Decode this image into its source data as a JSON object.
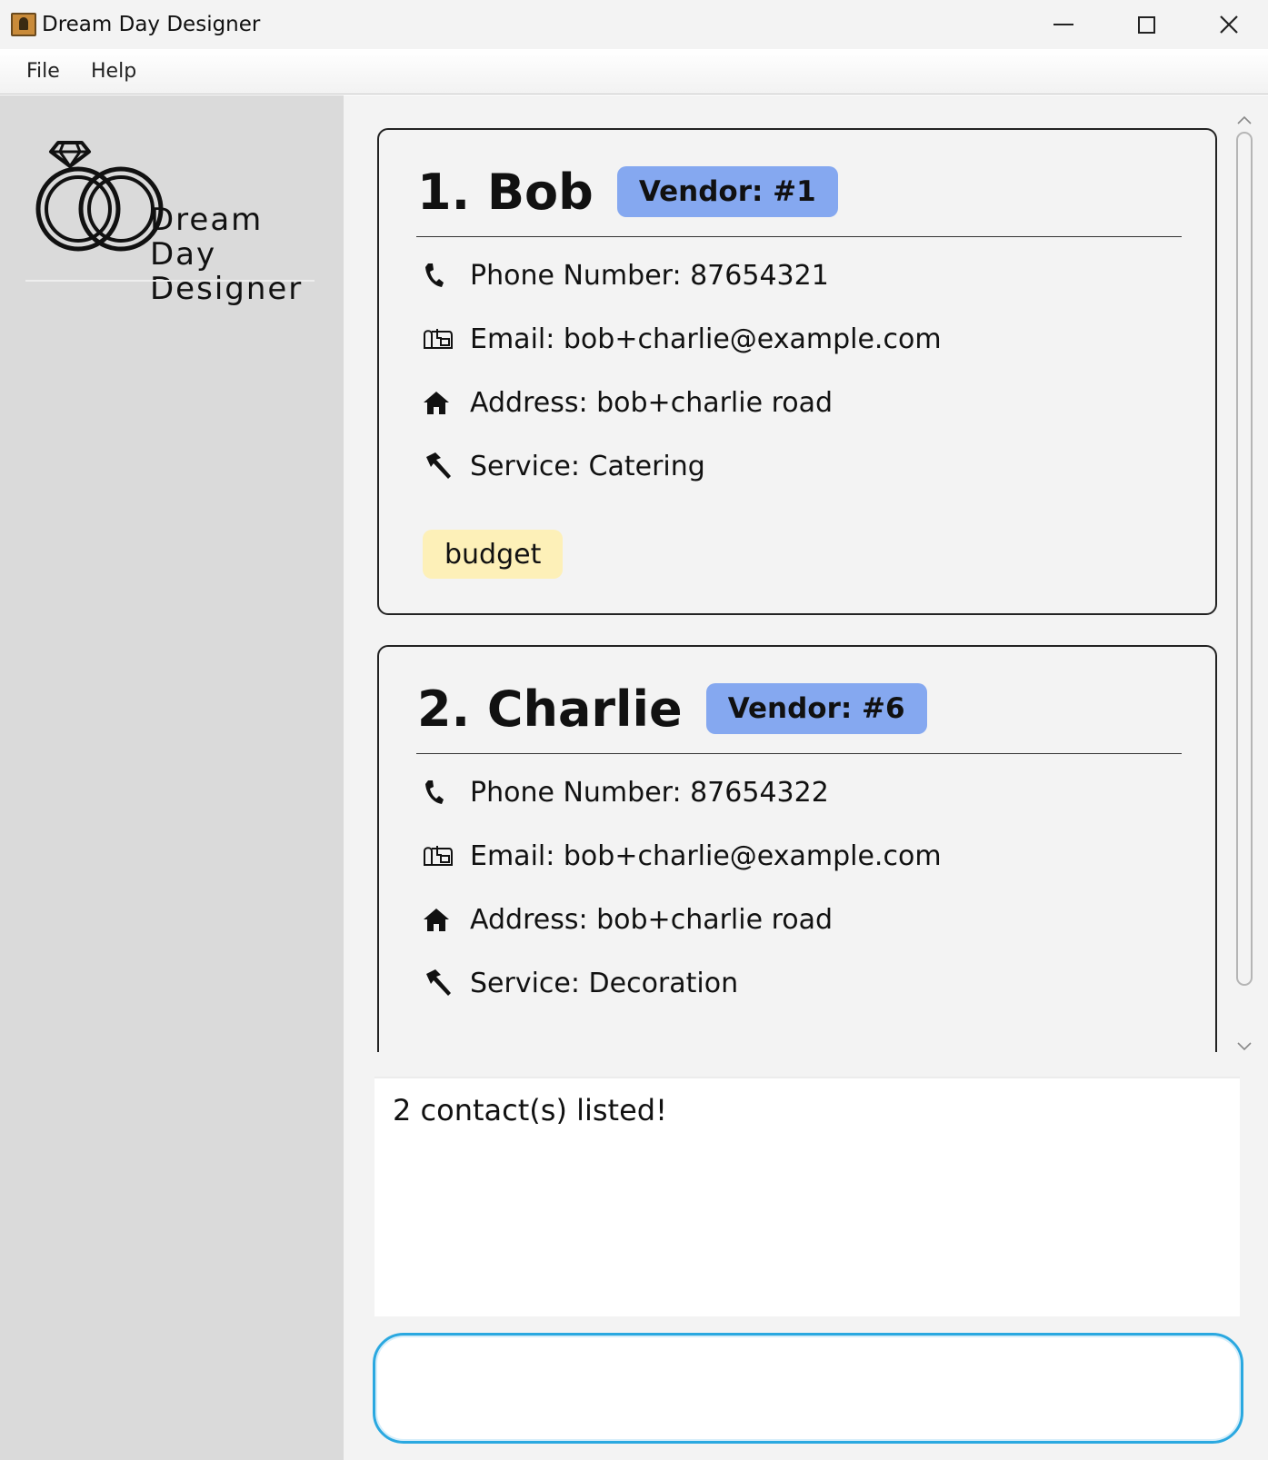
{
  "window": {
    "title": "Dream Day Designer",
    "controls": {
      "minimize": "minimize-icon",
      "maximize": "maximize-icon",
      "close": "close-icon"
    }
  },
  "menu": {
    "items": [
      {
        "label": "File"
      },
      {
        "label": "Help"
      }
    ]
  },
  "sidebar": {
    "logo": {
      "icon": "wedding-rings-icon",
      "lines": [
        "Dream",
        "Day",
        "Designer"
      ]
    }
  },
  "contacts": [
    {
      "name": "1. Bob",
      "vendor": "Vendor: #1",
      "phone": "Phone Number: 87654321",
      "email": "Email: bob+charlie@example.com",
      "address": "Address: bob+charlie road",
      "service": "Service: Catering",
      "tags": [
        "budget"
      ]
    },
    {
      "name": "2. Charlie",
      "vendor": "Vendor: #6",
      "phone": "Phone Number: 87654322",
      "email": "Email: bob+charlie@example.com",
      "address": "Address: bob+charlie road",
      "service": "Service: Decoration",
      "tags": []
    }
  ],
  "colors": {
    "vendor_badge": "#85a8f0",
    "tag": "#fdf0b8",
    "sidebar": "#dadada",
    "command_border": "#2aa8e0"
  },
  "result": {
    "message": "2 contact(s) listed!"
  },
  "command": {
    "value": "",
    "placeholder": ""
  }
}
